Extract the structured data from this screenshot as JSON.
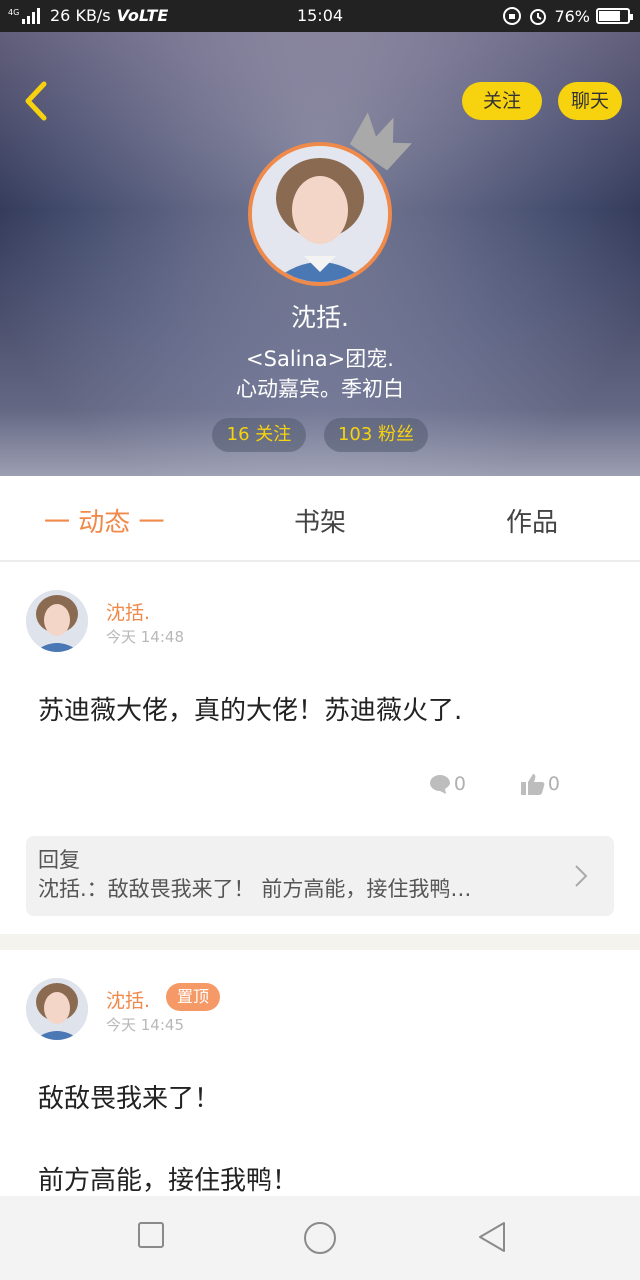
{
  "status_bar": {
    "network": "4G",
    "speed": "26 KB/s",
    "volte": "VoLTE",
    "time": "15:04",
    "battery": "76%"
  },
  "profile": {
    "name": "沈括.",
    "bio_line1": "<Salina>团宠.",
    "bio_line2": "心动嘉宾。季初白",
    "follow_button": "关注",
    "chat_button": "聊天",
    "following_stat": "16 关注",
    "fans_stat": "103 粉丝"
  },
  "tabs": [
    {
      "label": "一 动态 一",
      "active": true
    },
    {
      "label": "书架",
      "active": false
    },
    {
      "label": "作品",
      "active": false
    }
  ],
  "posts": [
    {
      "author": "沈括.",
      "time": "今天 14:48",
      "text": "苏迪薇大佬，真的大佬！苏迪薇火了.",
      "comments": "0",
      "likes": "0",
      "reply_title": "回复",
      "reply_text": "沈括.：敌敌畏我来了！ 前方高能，接住我鸭…"
    },
    {
      "author": "沈括.",
      "badge": "置顶",
      "time": "今天 14:45",
      "text_line1": "敌敌畏我来了！",
      "text_line2": "前方高能，接住我鸭！"
    }
  ],
  "colors": {
    "accent": "#f08a4b",
    "yellow": "#f7d20e",
    "pin_badge": "#f59a67"
  }
}
